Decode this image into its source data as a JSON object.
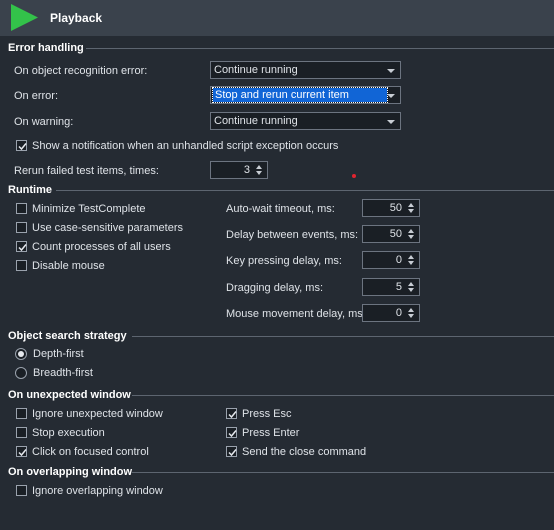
{
  "header": {
    "title": "Playback",
    "icon": "play-icon",
    "icon_color": "#33c24a"
  },
  "error_handling": {
    "title": "Error handling",
    "object_recognition": {
      "label": "On object recognition error:",
      "value": "Continue running"
    },
    "on_error": {
      "label": "On error:",
      "value": "Stop and rerun current item"
    },
    "on_warning": {
      "label": "On warning:",
      "value": "Continue running"
    },
    "show_notification": {
      "label": "Show a notification when an unhandled script exception occurs",
      "checked": true
    },
    "rerun": {
      "label": "Rerun failed test items, times:",
      "value": "3"
    }
  },
  "runtime": {
    "title": "Runtime",
    "options": [
      {
        "label": "Minimize TestComplete",
        "checked": false
      },
      {
        "label": "Use case-sensitive parameters",
        "checked": false
      },
      {
        "label": "Count processes of all users",
        "checked": true
      },
      {
        "label": "Disable mouse",
        "checked": false
      }
    ],
    "delays": [
      {
        "label": "Auto-wait timeout, ms:",
        "value": "50"
      },
      {
        "label": "Delay between events, ms:",
        "value": "50"
      },
      {
        "label": "Key pressing delay, ms:",
        "value": "0"
      },
      {
        "label": "Dragging delay, ms:",
        "value": "5"
      },
      {
        "label": "Mouse movement delay, ms:",
        "value": "0"
      }
    ]
  },
  "object_search": {
    "title": "Object search strategy",
    "options": [
      {
        "label": "Depth-first",
        "selected": true
      },
      {
        "label": "Breadth-first",
        "selected": false
      }
    ]
  },
  "unexpected_window": {
    "title": "On unexpected window",
    "left": [
      {
        "label": "Ignore unexpected window",
        "checked": false
      },
      {
        "label": "Stop execution",
        "checked": false
      },
      {
        "label": "Click on focused control",
        "checked": true
      }
    ],
    "right": [
      {
        "label": "Press Esc",
        "checked": true
      },
      {
        "label": "Press Enter",
        "checked": true
      },
      {
        "label": "Send the close command",
        "checked": true
      }
    ]
  },
  "overlapping_window": {
    "title": "On overlapping window",
    "option": {
      "label": "Ignore overlapping window",
      "checked": false
    }
  }
}
